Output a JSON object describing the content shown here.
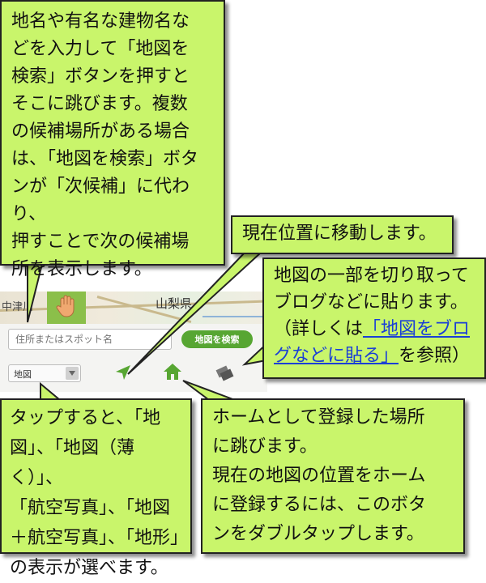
{
  "map": {
    "label_left": "中津川",
    "label_right": "山梨県"
  },
  "controls": {
    "search_placeholder": "住所またはスポット名",
    "search_button_label": "地図を検索",
    "map_type_value": "地図"
  },
  "callouts": {
    "search": [
      "地名や有名な建物名な",
      "どを入力して「地図を",
      "検索」ボタンを押すと",
      "そこに跳びます。複数",
      "の候補場所がある場合",
      "は、「地図を検索」ボタ",
      "ンが「次候補」に代わり、",
      "押すことで次の候補場",
      "所を表示します。"
    ],
    "location": "現在位置に移動します。",
    "clip": {
      "line1": "地図の一部を切り取って",
      "line2": "ブログなどに貼ります。",
      "line3_prefix": "（詳しくは",
      "link_part1": "「地図をブロ",
      "link_part2": "グなどに貼る」",
      "line4_suffix": "を参照）"
    },
    "maptype": [
      "タップすると、「地",
      "図」、「地図（薄く）」、",
      "「航空写真」、「地図",
      "＋航空写真」、「地形」",
      "の表示が選べます。"
    ],
    "home": [
      "ホームとして登録した場所",
      "に跳びます。",
      "現在の地図の位置をホーム",
      "に登録するには、このボタ",
      "ンをダブルタップします。"
    ]
  },
  "colors": {
    "callout_bg": "#c9f56b",
    "accent_green": "#57a632",
    "link_blue": "#1a3fd6"
  },
  "icons": [
    "hand-icon",
    "location-arrow-icon",
    "home-icon",
    "clip-icon",
    "dropdown-arrow-icon"
  ]
}
